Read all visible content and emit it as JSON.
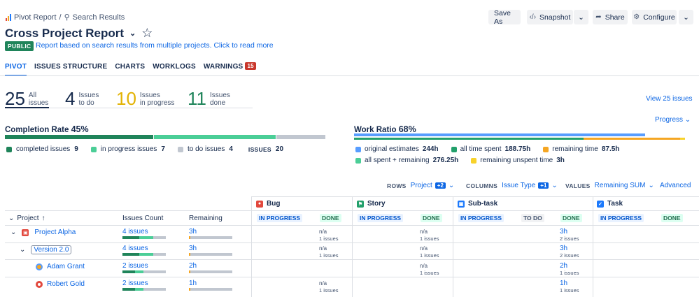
{
  "breadcrumb": {
    "root": "Pivot Report",
    "sep": "/",
    "current": "Search Results"
  },
  "title": "Cross Project Report",
  "visibility": "PUBLIC",
  "description": "Report based on search results from multiple projects. Click to read more",
  "actions": {
    "save_as": "Save As",
    "snapshot": "Snapshot",
    "share": "Share",
    "configure": "Configure"
  },
  "tabs": [
    {
      "label": "PIVOT"
    },
    {
      "label": "ISSUES STRUCTURE"
    },
    {
      "label": "CHARTS"
    },
    {
      "label": "WORKLOGS"
    },
    {
      "label": "WARNINGS",
      "badge": "15"
    }
  ],
  "counters": [
    {
      "num": "25",
      "l1": "All",
      "l2": "issues",
      "color": "#172b4d"
    },
    {
      "num": "4",
      "l1": "Issues",
      "l2": "to do",
      "color": "#172b4d"
    },
    {
      "num": "10",
      "l1": "Issues",
      "l2": "in progress",
      "color": "#e2b203"
    },
    {
      "num": "11",
      "l1": "Issues",
      "l2": "done",
      "color": "#1f845a"
    }
  ],
  "view_all": "View 25 issues",
  "progress_label": "Progress",
  "completion": {
    "title": "Completion Rate",
    "pct": "45%",
    "legend": [
      {
        "label": "completed issues",
        "value": "9",
        "color": "#1f845a"
      },
      {
        "label": "in progress issues",
        "value": "7",
        "color": "#4bce97"
      },
      {
        "label": "to do issues",
        "value": "4",
        "color": "#c1c7d0"
      }
    ],
    "total_label": "ISSUES",
    "total": "20"
  },
  "work": {
    "title": "Work Ratio",
    "pct": "68%",
    "legend": [
      {
        "label": "original estimates",
        "value": "244h",
        "color": "#579dff"
      },
      {
        "label": "all time spent",
        "value": "188.75h",
        "color": "#22a06b"
      },
      {
        "label": "remaining time",
        "value": "87.5h",
        "color": "#f5a623"
      },
      {
        "label": "all spent + remaining",
        "value": "276.25h",
        "color": "#4bce97"
      },
      {
        "label": "remaining unspent time",
        "value": "3h",
        "color": "#f8d22a"
      }
    ]
  },
  "controls": {
    "rows_label": "ROWS",
    "rows_value": "Project",
    "rows_plus": "+2",
    "cols_label": "COLUMNS",
    "cols_value": "Issue Type",
    "cols_plus": "+1",
    "values_label": "VALUES",
    "values_value": "Remaining SUM",
    "advanced": "Advanced"
  },
  "table": {
    "col_project": "Project",
    "col_count": "Issues Count",
    "col_remaining": "Remaining",
    "types": [
      {
        "name": "Bug",
        "color": "#e2483d",
        "statuses": [
          "IN PROGRESS",
          "DONE"
        ]
      },
      {
        "name": "Story",
        "color": "#22a06b",
        "statuses": [
          "IN PROGRESS",
          "DONE"
        ]
      },
      {
        "name": "Sub-task",
        "color": "#1d7afc",
        "statuses": [
          "IN PROGRESS",
          "TO DO",
          "DONE"
        ]
      },
      {
        "name": "Task",
        "color": "#1d7afc",
        "statuses": [
          "IN PROGRESS",
          "DONE"
        ]
      }
    ],
    "rows": [
      {
        "name": "Project Alpha",
        "count": "4 issues",
        "remaining": "3h",
        "bug_done": "",
        "bug_done_sub": "",
        "bug_prog": "n/a",
        "bug_prog_sub": "1 issues",
        "story_done": "n/a",
        "story_done_sub": "1 issues",
        "sub_done": "3h",
        "sub_done_sub": "2 issues"
      },
      {
        "name": "Version 2.0",
        "count": "4 issues",
        "remaining": "3h",
        "bug_prog": "n/a",
        "bug_prog_sub": "1 issues",
        "story_done": "n/a",
        "story_done_sub": "1 issues",
        "sub_done": "3h",
        "sub_done_sub": "2 issues"
      },
      {
        "name": "Adam Grant",
        "count": "2 issues",
        "remaining": "2h",
        "bug_prog": "",
        "bug_prog_sub": "",
        "story_done": "n/a",
        "story_done_sub": "1 issues",
        "sub_done": "2h",
        "sub_done_sub": "1 issues"
      },
      {
        "name": "Robert Gold",
        "count": "2 issues",
        "remaining": "1h",
        "bug_prog": "n/a",
        "bug_prog_sub": "1 issues",
        "story_done": "",
        "story_done_sub": "",
        "sub_done": "1h",
        "sub_done_sub": "1 issues"
      }
    ]
  }
}
